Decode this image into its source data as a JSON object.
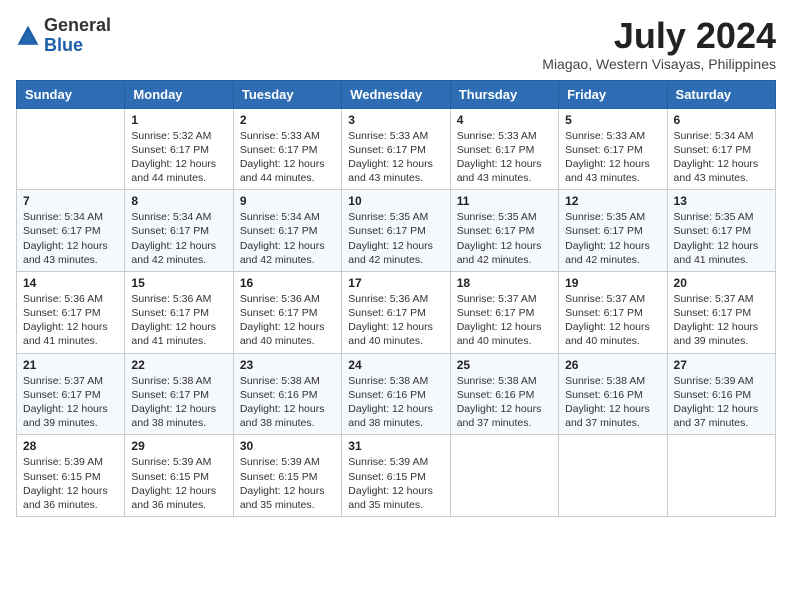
{
  "header": {
    "logo_general": "General",
    "logo_blue": "Blue",
    "month_year": "July 2024",
    "location": "Miagao, Western Visayas, Philippines"
  },
  "days_of_week": [
    "Sunday",
    "Monday",
    "Tuesday",
    "Wednesday",
    "Thursday",
    "Friday",
    "Saturday"
  ],
  "weeks": [
    [
      {
        "day": "",
        "sunrise": "",
        "sunset": "",
        "daylight": ""
      },
      {
        "day": "1",
        "sunrise": "Sunrise: 5:32 AM",
        "sunset": "Sunset: 6:17 PM",
        "daylight": "Daylight: 12 hours and 44 minutes."
      },
      {
        "day": "2",
        "sunrise": "Sunrise: 5:33 AM",
        "sunset": "Sunset: 6:17 PM",
        "daylight": "Daylight: 12 hours and 44 minutes."
      },
      {
        "day": "3",
        "sunrise": "Sunrise: 5:33 AM",
        "sunset": "Sunset: 6:17 PM",
        "daylight": "Daylight: 12 hours and 43 minutes."
      },
      {
        "day": "4",
        "sunrise": "Sunrise: 5:33 AM",
        "sunset": "Sunset: 6:17 PM",
        "daylight": "Daylight: 12 hours and 43 minutes."
      },
      {
        "day": "5",
        "sunrise": "Sunrise: 5:33 AM",
        "sunset": "Sunset: 6:17 PM",
        "daylight": "Daylight: 12 hours and 43 minutes."
      },
      {
        "day": "6",
        "sunrise": "Sunrise: 5:34 AM",
        "sunset": "Sunset: 6:17 PM",
        "daylight": "Daylight: 12 hours and 43 minutes."
      }
    ],
    [
      {
        "day": "7",
        "sunrise": "Sunrise: 5:34 AM",
        "sunset": "Sunset: 6:17 PM",
        "daylight": "Daylight: 12 hours and 43 minutes."
      },
      {
        "day": "8",
        "sunrise": "Sunrise: 5:34 AM",
        "sunset": "Sunset: 6:17 PM",
        "daylight": "Daylight: 12 hours and 42 minutes."
      },
      {
        "day": "9",
        "sunrise": "Sunrise: 5:34 AM",
        "sunset": "Sunset: 6:17 PM",
        "daylight": "Daylight: 12 hours and 42 minutes."
      },
      {
        "day": "10",
        "sunrise": "Sunrise: 5:35 AM",
        "sunset": "Sunset: 6:17 PM",
        "daylight": "Daylight: 12 hours and 42 minutes."
      },
      {
        "day": "11",
        "sunrise": "Sunrise: 5:35 AM",
        "sunset": "Sunset: 6:17 PM",
        "daylight": "Daylight: 12 hours and 42 minutes."
      },
      {
        "day": "12",
        "sunrise": "Sunrise: 5:35 AM",
        "sunset": "Sunset: 6:17 PM",
        "daylight": "Daylight: 12 hours and 42 minutes."
      },
      {
        "day": "13",
        "sunrise": "Sunrise: 5:35 AM",
        "sunset": "Sunset: 6:17 PM",
        "daylight": "Daylight: 12 hours and 41 minutes."
      }
    ],
    [
      {
        "day": "14",
        "sunrise": "Sunrise: 5:36 AM",
        "sunset": "Sunset: 6:17 PM",
        "daylight": "Daylight: 12 hours and 41 minutes."
      },
      {
        "day": "15",
        "sunrise": "Sunrise: 5:36 AM",
        "sunset": "Sunset: 6:17 PM",
        "daylight": "Daylight: 12 hours and 41 minutes."
      },
      {
        "day": "16",
        "sunrise": "Sunrise: 5:36 AM",
        "sunset": "Sunset: 6:17 PM",
        "daylight": "Daylight: 12 hours and 40 minutes."
      },
      {
        "day": "17",
        "sunrise": "Sunrise: 5:36 AM",
        "sunset": "Sunset: 6:17 PM",
        "daylight": "Daylight: 12 hours and 40 minutes."
      },
      {
        "day": "18",
        "sunrise": "Sunrise: 5:37 AM",
        "sunset": "Sunset: 6:17 PM",
        "daylight": "Daylight: 12 hours and 40 minutes."
      },
      {
        "day": "19",
        "sunrise": "Sunrise: 5:37 AM",
        "sunset": "Sunset: 6:17 PM",
        "daylight": "Daylight: 12 hours and 40 minutes."
      },
      {
        "day": "20",
        "sunrise": "Sunrise: 5:37 AM",
        "sunset": "Sunset: 6:17 PM",
        "daylight": "Daylight: 12 hours and 39 minutes."
      }
    ],
    [
      {
        "day": "21",
        "sunrise": "Sunrise: 5:37 AM",
        "sunset": "Sunset: 6:17 PM",
        "daylight": "Daylight: 12 hours and 39 minutes."
      },
      {
        "day": "22",
        "sunrise": "Sunrise: 5:38 AM",
        "sunset": "Sunset: 6:17 PM",
        "daylight": "Daylight: 12 hours and 38 minutes."
      },
      {
        "day": "23",
        "sunrise": "Sunrise: 5:38 AM",
        "sunset": "Sunset: 6:16 PM",
        "daylight": "Daylight: 12 hours and 38 minutes."
      },
      {
        "day": "24",
        "sunrise": "Sunrise: 5:38 AM",
        "sunset": "Sunset: 6:16 PM",
        "daylight": "Daylight: 12 hours and 38 minutes."
      },
      {
        "day": "25",
        "sunrise": "Sunrise: 5:38 AM",
        "sunset": "Sunset: 6:16 PM",
        "daylight": "Daylight: 12 hours and 37 minutes."
      },
      {
        "day": "26",
        "sunrise": "Sunrise: 5:38 AM",
        "sunset": "Sunset: 6:16 PM",
        "daylight": "Daylight: 12 hours and 37 minutes."
      },
      {
        "day": "27",
        "sunrise": "Sunrise: 5:39 AM",
        "sunset": "Sunset: 6:16 PM",
        "daylight": "Daylight: 12 hours and 37 minutes."
      }
    ],
    [
      {
        "day": "28",
        "sunrise": "Sunrise: 5:39 AM",
        "sunset": "Sunset: 6:15 PM",
        "daylight": "Daylight: 12 hours and 36 minutes."
      },
      {
        "day": "29",
        "sunrise": "Sunrise: 5:39 AM",
        "sunset": "Sunset: 6:15 PM",
        "daylight": "Daylight: 12 hours and 36 minutes."
      },
      {
        "day": "30",
        "sunrise": "Sunrise: 5:39 AM",
        "sunset": "Sunset: 6:15 PM",
        "daylight": "Daylight: 12 hours and 35 minutes."
      },
      {
        "day": "31",
        "sunrise": "Sunrise: 5:39 AM",
        "sunset": "Sunset: 6:15 PM",
        "daylight": "Daylight: 12 hours and 35 minutes."
      },
      {
        "day": "",
        "sunrise": "",
        "sunset": "",
        "daylight": ""
      },
      {
        "day": "",
        "sunrise": "",
        "sunset": "",
        "daylight": ""
      },
      {
        "day": "",
        "sunrise": "",
        "sunset": "",
        "daylight": ""
      }
    ]
  ]
}
